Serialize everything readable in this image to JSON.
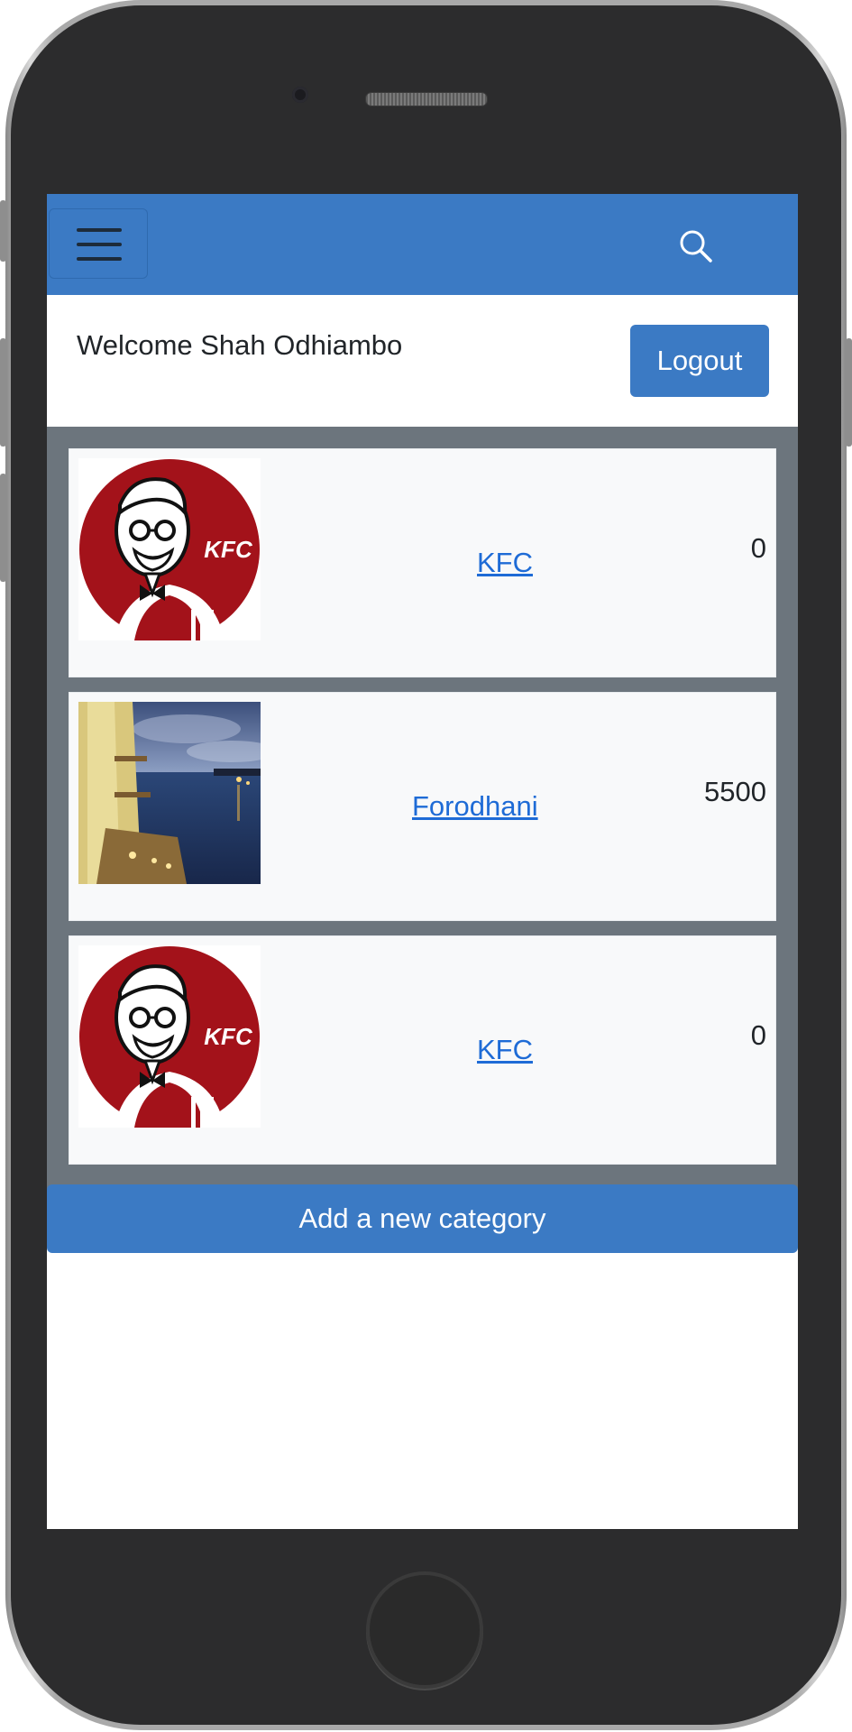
{
  "navbar": {
    "menu_icon": "hamburger-menu-icon",
    "search_icon": "search-icon",
    "accent_color": "#3b7ac4"
  },
  "header": {
    "welcome_text": "Welcome Shah Odhiambo",
    "logout_label": "Logout"
  },
  "categories": [
    {
      "name": "KFC",
      "count": "0",
      "thumbnail": "kfc-logo"
    },
    {
      "name": "Forodhani",
      "count": "5500",
      "thumbnail": "waterfront-photo"
    },
    {
      "name": "KFC",
      "count": "0",
      "thumbnail": "kfc-logo"
    }
  ],
  "footer": {
    "add_label": "Add a new category"
  }
}
